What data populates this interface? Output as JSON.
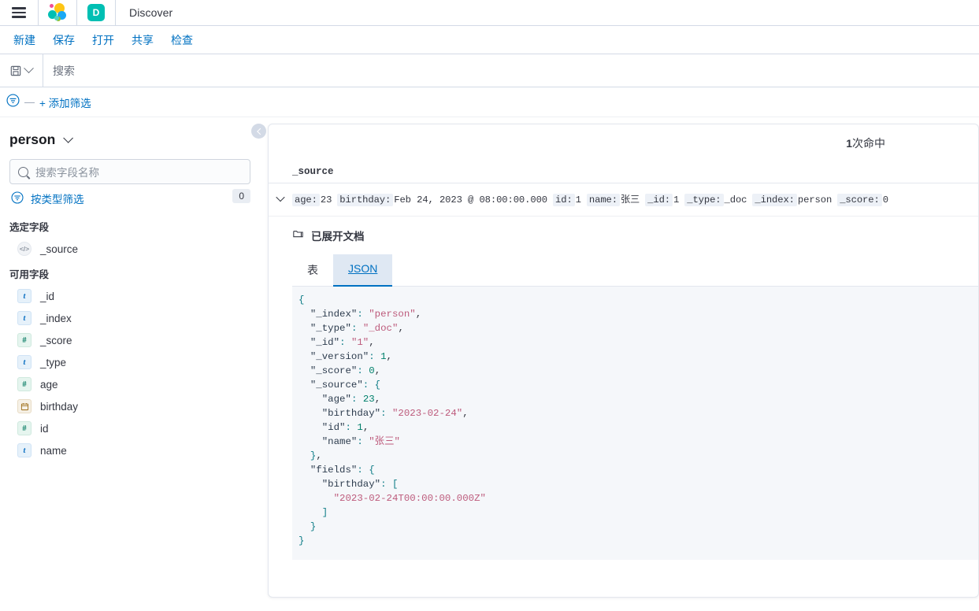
{
  "chrome": {
    "menu_icon": "hamburger-menu-icon",
    "logo_icon": "elastic-logo-icon",
    "app_badge": "D",
    "title": "Discover"
  },
  "menubar": {
    "items": [
      {
        "label": "新建",
        "name": "new"
      },
      {
        "label": "保存",
        "name": "save"
      },
      {
        "label": "打开",
        "name": "open"
      },
      {
        "label": "共享",
        "name": "share"
      },
      {
        "label": "检查",
        "name": "inspect"
      }
    ]
  },
  "querybar": {
    "saved_query_icon": "save-floppy-icon",
    "dropdown_icon": "chevron-down-icon",
    "search_placeholder": "搜索",
    "search_value": ""
  },
  "filterbar": {
    "filter_icon": "filter-funnel-icon",
    "separator": "—",
    "add_filter_label": "+ 添加筛选"
  },
  "sidebar": {
    "index_pattern": "person",
    "index_pattern_chevron": "chevron-down-icon",
    "field_search_placeholder": "搜索字段名称",
    "field_search_value": "",
    "search_icon": "search-icon",
    "type_filter_label": "按类型筛选",
    "type_filter_icon": "filter-funnel-icon",
    "type_filter_count": "0",
    "selected_fields_heading": "选定字段",
    "selected_fields": [
      {
        "name": "_source",
        "type": "source",
        "glyph": "</>"
      }
    ],
    "available_fields_heading": "可用字段",
    "available_fields": [
      {
        "name": "_id",
        "type": "string",
        "glyph": "t"
      },
      {
        "name": "_index",
        "type": "string",
        "glyph": "t"
      },
      {
        "name": "_score",
        "type": "number",
        "glyph": "#"
      },
      {
        "name": "_type",
        "type": "string",
        "glyph": "t"
      },
      {
        "name": "age",
        "type": "number",
        "glyph": "#"
      },
      {
        "name": "birthday",
        "type": "date",
        "glyph": ""
      },
      {
        "name": "id",
        "type": "number",
        "glyph": "#"
      },
      {
        "name": "name",
        "type": "string",
        "glyph": "t"
      }
    ],
    "collapse_icon": "chevron-left-icon"
  },
  "main": {
    "hits_count": "1",
    "hits_label": "次命中",
    "column_header": "_source",
    "expand_row_icon": "chevron-down-icon",
    "doc_summary": [
      {
        "key": "age:",
        "value": "23"
      },
      {
        "key": "birthday:",
        "value": "Feb 24, 2023 @ 08:00:00.000"
      },
      {
        "key": "id:",
        "value": "1"
      },
      {
        "key": "name:",
        "value": "张三"
      },
      {
        "key": "_id:",
        "value": "1"
      },
      {
        "key": "_type:",
        "value": "_doc"
      },
      {
        "key": "_index:",
        "value": "person"
      },
      {
        "key": "_score:",
        "value": "0"
      }
    ],
    "expanded_title": "已展开文档",
    "expanded_icon": "folder-icon",
    "tabs": [
      {
        "label": "表",
        "active": false
      },
      {
        "label": "JSON",
        "active": true
      }
    ],
    "json_document": {
      "_index": "person",
      "_type": "_doc",
      "_id": "1",
      "_version": 1,
      "_score": 0,
      "_source": {
        "age": 23,
        "birthday": "2023-02-24",
        "id": 1,
        "name": "张三"
      },
      "fields": {
        "birthday": [
          "2023-02-24T00:00:00.000Z"
        ]
      }
    }
  },
  "colors": {
    "brand_teal": "#00bfb3",
    "link_blue": "#0071c2",
    "tab_active_bg": "#dfe8f3",
    "json_bg": "#f5f7fa",
    "string_color": "#bd5b7c",
    "number_color": "#00806b"
  }
}
